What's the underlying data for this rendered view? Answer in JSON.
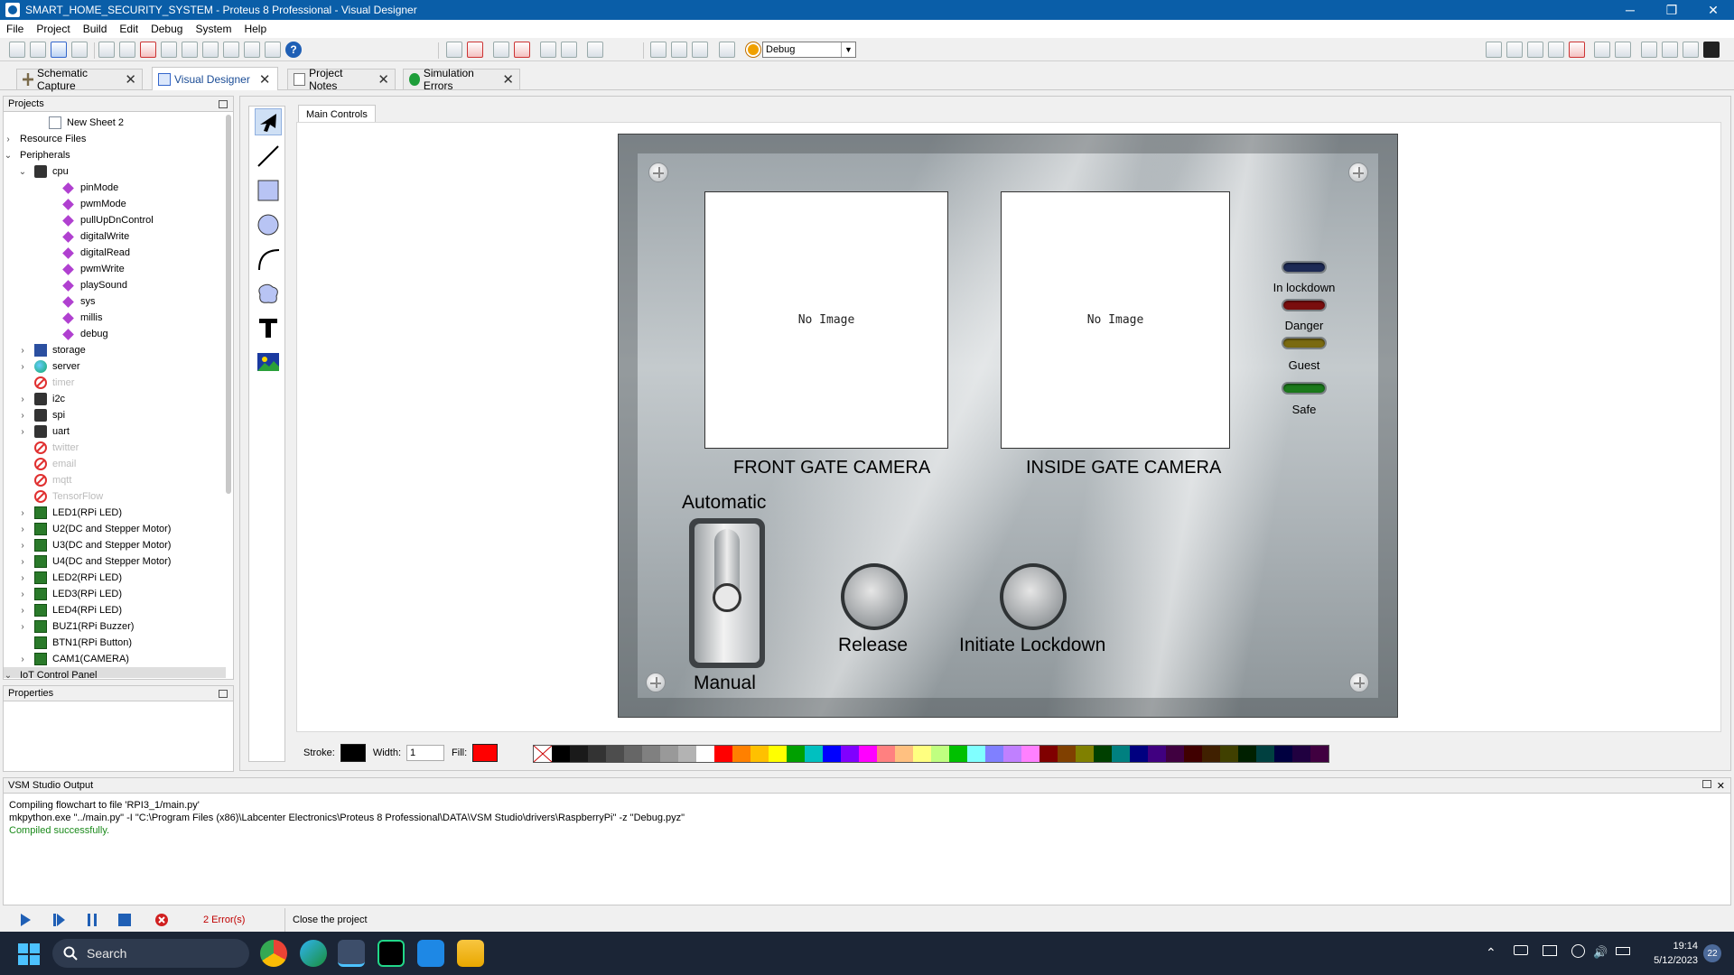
{
  "window": {
    "title": "SMART_HOME_SECURITY_SYSTEM - Proteus 8 Professional - Visual Designer",
    "controls": [
      "─",
      "❐",
      "✕"
    ]
  },
  "menu": [
    "File",
    "Project",
    "Build",
    "Edit",
    "Debug",
    "System",
    "Help"
  ],
  "toolbar": {
    "config_value": "Debug",
    "help_label": "?"
  },
  "tabs": [
    {
      "label": "Schematic Capture",
      "icon": "schematic-icon"
    },
    {
      "label": "Visual Designer",
      "icon": "visual-designer-icon"
    },
    {
      "label": "Project Notes",
      "icon": "notes-icon"
    },
    {
      "label": "Simulation Errors",
      "icon": "info-icon"
    }
  ],
  "projects_panel": {
    "title": "Projects",
    "items": [
      {
        "label": "New Sheet 2",
        "icon": "sheet-icon"
      },
      {
        "label": "Resource Files",
        "icon": "none"
      },
      {
        "label": "Peripherals",
        "icon": "none"
      },
      {
        "label": "cpu",
        "icon": "chip-icon"
      },
      {
        "label": "pinMode",
        "icon": "method-icon"
      },
      {
        "label": "pwmMode",
        "icon": "method-icon"
      },
      {
        "label": "pullUpDnControl",
        "icon": "method-icon"
      },
      {
        "label": "digitalWrite",
        "icon": "method-icon"
      },
      {
        "label": "digitalRead",
        "icon": "method-icon"
      },
      {
        "label": "pwmWrite",
        "icon": "method-icon"
      },
      {
        "label": "playSound",
        "icon": "method-icon"
      },
      {
        "label": "sys",
        "icon": "method-icon"
      },
      {
        "label": "millis",
        "icon": "method-icon"
      },
      {
        "label": "debug",
        "icon": "method-icon"
      },
      {
        "label": "storage",
        "icon": "storage-icon"
      },
      {
        "label": "server",
        "icon": "globe-icon"
      },
      {
        "label": "timer",
        "icon": "disabled-icon"
      },
      {
        "label": "i2c",
        "icon": "chip-icon"
      },
      {
        "label": "spi",
        "icon": "chip-icon"
      },
      {
        "label": "uart",
        "icon": "chip-icon"
      },
      {
        "label": "twitter",
        "icon": "disabled-icon"
      },
      {
        "label": "email",
        "icon": "disabled-icon"
      },
      {
        "label": "mqtt",
        "icon": "disabled-icon"
      },
      {
        "label": "TensorFlow",
        "icon": "disabled-icon"
      },
      {
        "label": "LED1(RPi LED)",
        "icon": "board-icon"
      },
      {
        "label": "U2(DC and Stepper Motor)",
        "icon": "board-icon"
      },
      {
        "label": "U3(DC and Stepper Motor)",
        "icon": "board-icon"
      },
      {
        "label": "U4(DC and Stepper Motor)",
        "icon": "board-icon"
      },
      {
        "label": "LED2(RPi LED)",
        "icon": "board-icon"
      },
      {
        "label": "LED3(RPi LED)",
        "icon": "board-icon"
      },
      {
        "label": "LED4(RPi LED)",
        "icon": "board-icon"
      },
      {
        "label": "BUZ1(RPi Buzzer)",
        "icon": "board-icon"
      },
      {
        "label": "BTN1(RPi Button)",
        "icon": "board-icon"
      },
      {
        "label": "CAM1(CAMERA)",
        "icon": "board-icon"
      },
      {
        "label": "IoT Control Panel",
        "icon": "none"
      }
    ]
  },
  "properties_panel": {
    "title": "Properties"
  },
  "designer": {
    "subtab": "Main Controls",
    "front_camera": {
      "image_text": "No Image",
      "label": "FRONT GATE CAMERA"
    },
    "inside_camera": {
      "image_text": "No Image",
      "label": "INSIDE GATE CAMERA"
    },
    "leds": [
      {
        "label": "In lockdown",
        "color": "#1d2a55"
      },
      {
        "label": "Danger",
        "color": "#7a0e0e"
      },
      {
        "label": "Guest",
        "color": "#7a6a10"
      },
      {
        "label": "Safe",
        "color": "#1b7a1b"
      }
    ],
    "toggle": {
      "top_label": "Automatic",
      "bottom_label": "Manual"
    },
    "buttons": [
      {
        "label": "Release"
      },
      {
        "label": "Initiate Lockdown"
      }
    ]
  },
  "style_bar": {
    "stroke_label": "Stroke:",
    "stroke_color": "#000000",
    "width_label": "Width:",
    "width_value": "1",
    "fill_label": "Fill:",
    "fill_color": "#ff0000",
    "palette": [
      "#000000",
      "#1a1a1a",
      "#333333",
      "#4d4d4d",
      "#666666",
      "#808080",
      "#999999",
      "#b3b3b3",
      "#ffffff",
      "#ff0000",
      "#ff8000",
      "#ffc000",
      "#ffff00",
      "#00a000",
      "#00c0c0",
      "#0000ff",
      "#8000ff",
      "#ff00ff",
      "#ff8080",
      "#ffc080",
      "#ffff80",
      "#c0ff80",
      "#00c000",
      "#80ffff",
      "#8080ff",
      "#c080ff",
      "#ff80ff",
      "#800000",
      "#804000",
      "#808000",
      "#004000",
      "#008080",
      "#000080",
      "#400080",
      "#400040",
      "#400000",
      "#402000",
      "#404000",
      "#002000",
      "#004040",
      "#000040",
      "#200040",
      "#400040"
    ]
  },
  "output": {
    "title": "VSM Studio Output",
    "lines": [
      "Compiling flowchart to file 'RPI3_1/main.py'",
      "mkpython.exe \"../main.py\" -I \"C:\\Program Files (x86)\\Labcenter Electronics\\Proteus 8 Professional\\DATA\\VSM Studio\\drivers\\RaspberryPi\" -z \"Debug.pyz\""
    ],
    "success": "Compiled successfully."
  },
  "statusbar": {
    "errors": "2 Error(s)",
    "message": "Close the project"
  },
  "taskbar": {
    "search": "Search",
    "time": "19:14",
    "date": "5/12/2023",
    "notifications": "22"
  }
}
